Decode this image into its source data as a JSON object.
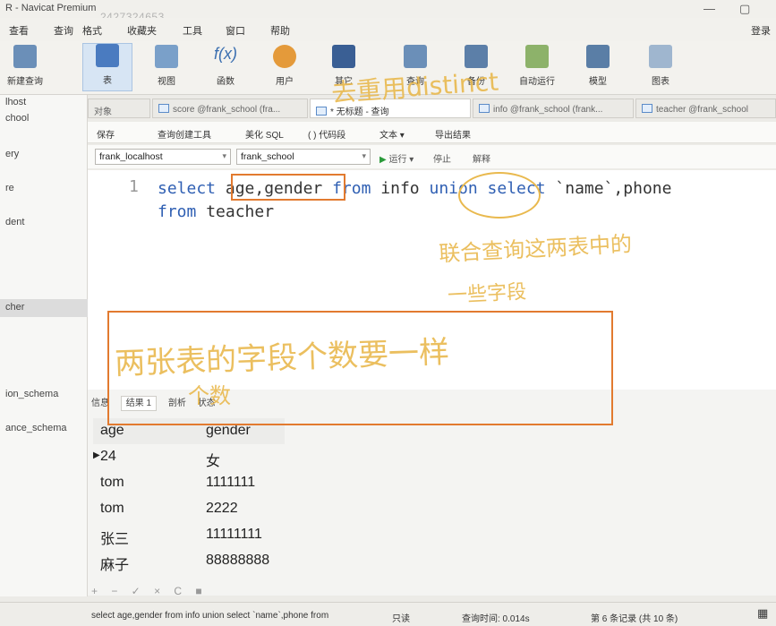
{
  "window": {
    "title": "R - Navicat Premium",
    "watermark": "2427324653",
    "menu": [
      "查看",
      "查询",
      "格式",
      "收藏夹",
      "工具",
      "窗口",
      "帮助"
    ],
    "login": "登录",
    "controls": [
      "—",
      "▢"
    ]
  },
  "toolbar": {
    "items": [
      "新建查询",
      "表",
      "视图",
      "函数",
      "用户",
      "其它",
      "查询",
      "备份",
      "自动运行",
      "模型",
      "图表"
    ],
    "active": "表"
  },
  "sidebar": {
    "items": [
      "lhost",
      "chool",
      "ery",
      "re",
      "dent",
      "cher",
      "ion_schema",
      "ance_schema"
    ]
  },
  "tabs": [
    {
      "label": "对象",
      "active": false
    },
    {
      "label": "score @frank_school (fra...",
      "active": false
    },
    {
      "label": "* 无标题 - 查询",
      "active": true
    },
    {
      "label": "info @frank_school (frank...",
      "active": false
    },
    {
      "label": "teacher @frank_school",
      "active": false
    }
  ],
  "query_toolbar": [
    "保存",
    "查询创建工具",
    "美化 SQL",
    "( ) 代码段",
    "文本 ▾",
    "导出结果"
  ],
  "connection": {
    "server": "frank_localhost",
    "database": "frank_school",
    "run": "运行 ▾",
    "stop": "停止",
    "explain": "解释"
  },
  "editor": {
    "line_number": "1",
    "line1": {
      "kw_select": "select",
      "cols": "age,gender",
      "kw_from": "from",
      "tbl1": "info",
      "kw_union": "union",
      "kw_select2": "select",
      "rest": "`name`,phone"
    },
    "line2": {
      "kw_from": "from",
      "tbl2": "teacher"
    }
  },
  "result_tabs": [
    "信息",
    "结果 1",
    "剖析",
    "状态"
  ],
  "results": {
    "columns": [
      "age",
      "gender"
    ],
    "rows": [
      [
        "24",
        "女"
      ],
      [
        "tom",
        "1111111"
      ],
      [
        "tom",
        "2222"
      ],
      [
        "张三",
        "11111111"
      ],
      [
        "麻子",
        "88888888"
      ]
    ]
  },
  "grid_footer": "+ − ✓ × C ■",
  "statusbar": {
    "sql": "select age,gender from info union select `name`,phone from",
    "mode": "只读",
    "query_time": "查询时间: 0.014s",
    "records": "第 6 条记录 (共 10 条)"
  },
  "annotations": {
    "top": "去重用distinct",
    "middle": "联合查询这两表中的",
    "middle2": "一些字段",
    "box": "两张表的字段个数要一样",
    "box2": "个数"
  },
  "colors": {
    "accent_box": "#e27a2f",
    "handwriting": "#e9b94e",
    "keyword": "#2f5fb3"
  }
}
